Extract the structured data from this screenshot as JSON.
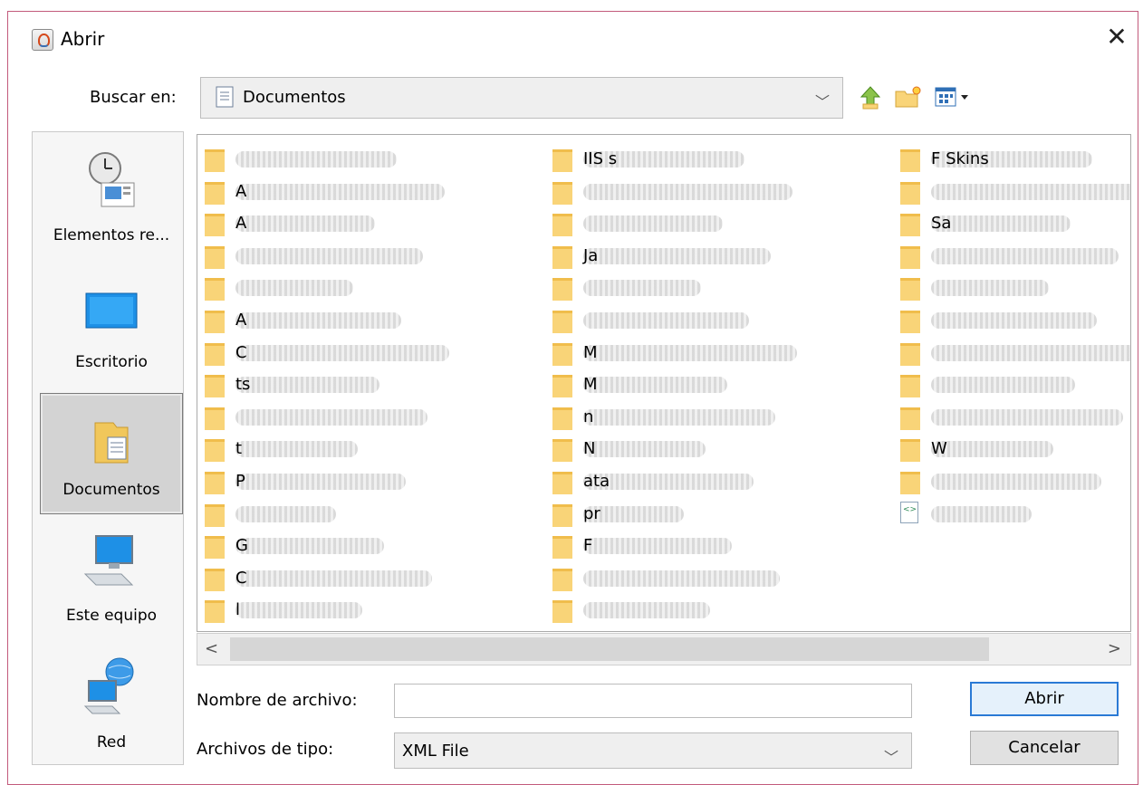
{
  "window": {
    "title": "Abrir",
    "close": "✕"
  },
  "toolbar": {
    "look_in_label": "Buscar en:",
    "look_in_value": "Documentos"
  },
  "places": [
    {
      "label": "Elementos re...",
      "icon": "recent-items-icon"
    },
    {
      "label": "Escritorio",
      "icon": "desktop-icon"
    },
    {
      "label": "Documentos",
      "icon": "documents-icon",
      "selected": true
    },
    {
      "label": "Este equipo",
      "icon": "computer-icon"
    },
    {
      "label": "Red",
      "icon": "network-icon"
    }
  ],
  "files": {
    "col1": [
      "",
      "A",
      "A",
      "",
      "",
      "A",
      "C",
      "ts",
      "",
      "t",
      "P",
      "",
      "G",
      "C",
      "l"
    ],
    "col2": [
      "IIS  s",
      "",
      "",
      "Ja",
      "",
      "",
      "M",
      "M",
      "n",
      "N",
      "ata",
      "pr",
      "F",
      "",
      ""
    ],
    "col3": [
      "F  Skins",
      "",
      "Sa",
      "",
      "",
      "",
      "",
      "",
      "",
      "W",
      "",
      ""
    ]
  },
  "form": {
    "filename_label": "Nombre de archivo:",
    "filename_value": "",
    "filetype_label": "Archivos de tipo:",
    "filetype_value": "XML File"
  },
  "buttons": {
    "open": "Abrir",
    "cancel": "Cancelar"
  },
  "scrollbar": {
    "left": "<",
    "right": ">"
  }
}
